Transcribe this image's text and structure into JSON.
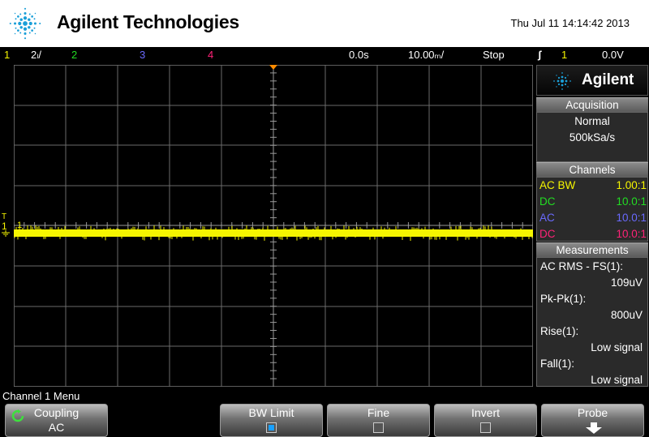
{
  "header": {
    "brand": "Agilent Technologies",
    "datetime": "Thu Jul 11 14:14:42 2013"
  },
  "status": {
    "ch1_num": "1",
    "ch1_scale": "2ₗ/",
    "ch2_num": "2",
    "ch3_num": "3",
    "ch4_num": "4",
    "time_delay": "0.0s",
    "time_scale": "10.00ₘ/",
    "run_state": "Stop",
    "trigger_icon": "ʃ",
    "trigger_source": "1",
    "trigger_level": "0.0V"
  },
  "colors": {
    "ch1": "#f5f500",
    "ch2": "#22dd22",
    "ch3": "#6a6aff",
    "ch4": "#ff2277",
    "grid": "#7a7a7a",
    "trigger_marker": "#ff8c00"
  },
  "display": {
    "ch1_marker": "1",
    "trigger_marker": "T"
  },
  "side_panel": {
    "logo_text": "Agilent",
    "acquisition": {
      "title": "Acquisition",
      "mode": "Normal",
      "rate": "500kSa/s"
    },
    "channels": {
      "title": "Channels",
      "rows": [
        {
          "coupling": "AC BW",
          "probe": "1.00:1"
        },
        {
          "coupling": "DC",
          "probe": "10.0:1"
        },
        {
          "coupling": "AC",
          "probe": "10.0:1"
        },
        {
          "coupling": "DC",
          "probe": "10.0:1"
        }
      ]
    },
    "measurements": {
      "title": "Measurements",
      "items": [
        {
          "name": "AC RMS - FS(1):",
          "value": "109uV"
        },
        {
          "name": "Pk-Pk(1):",
          "value": "800uV"
        },
        {
          "name": "Rise(1):",
          "value": "Low signal"
        },
        {
          "name": "Fall(1):",
          "value": "Low signal"
        }
      ]
    }
  },
  "menu": {
    "title": "Channel 1 Menu",
    "softkeys": [
      {
        "label": "Coupling",
        "value": "AC",
        "icon": "rotate-icon"
      },
      {
        "label": "BW Limit",
        "checked": true
      },
      {
        "label": "Fine",
        "checked": false
      },
      {
        "label": "Invert",
        "checked": false
      },
      {
        "label": "Probe",
        "icon": "down-arrow-icon"
      }
    ]
  }
}
